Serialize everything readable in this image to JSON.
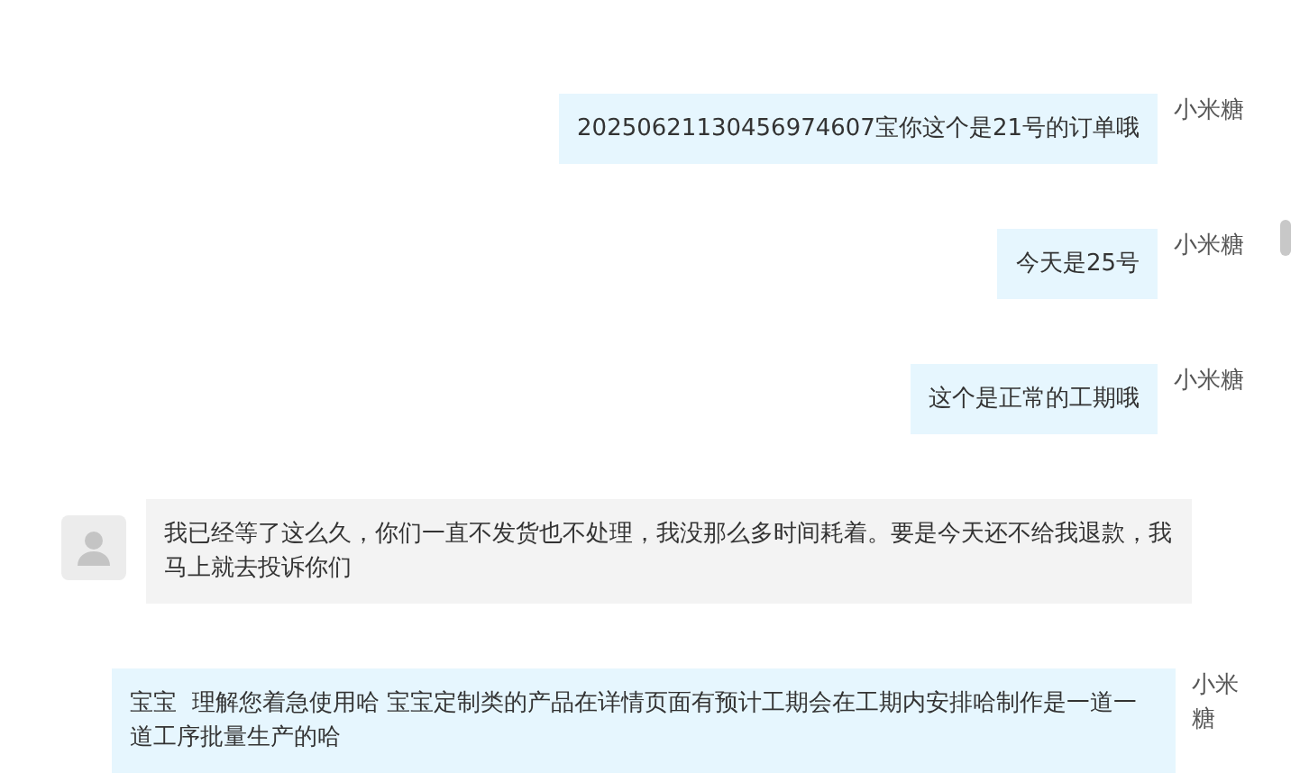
{
  "messages": [
    {
      "kind": "agent",
      "sender": "小米糖",
      "text": "20250621130456974607宝你这个是21号的订单哦"
    },
    {
      "kind": "agent",
      "sender": "小米糖",
      "text": "今天是25号"
    },
    {
      "kind": "agent",
      "sender": "小米糖",
      "text": "这个是正常的工期哦"
    },
    {
      "kind": "customer",
      "text": "我已经等了这么久，你们一直不发货也不处理，我没那么多时间耗着。要是今天还不给我退款，我马上就去投诉你们"
    },
    {
      "kind": "agent",
      "sender": "小米糖",
      "text": "宝宝  理解您着急使用哈 宝宝定制类的产品在详情页面有预计工期会在工期内安排哈制作是一道一道工序批量生产的哈"
    }
  ]
}
